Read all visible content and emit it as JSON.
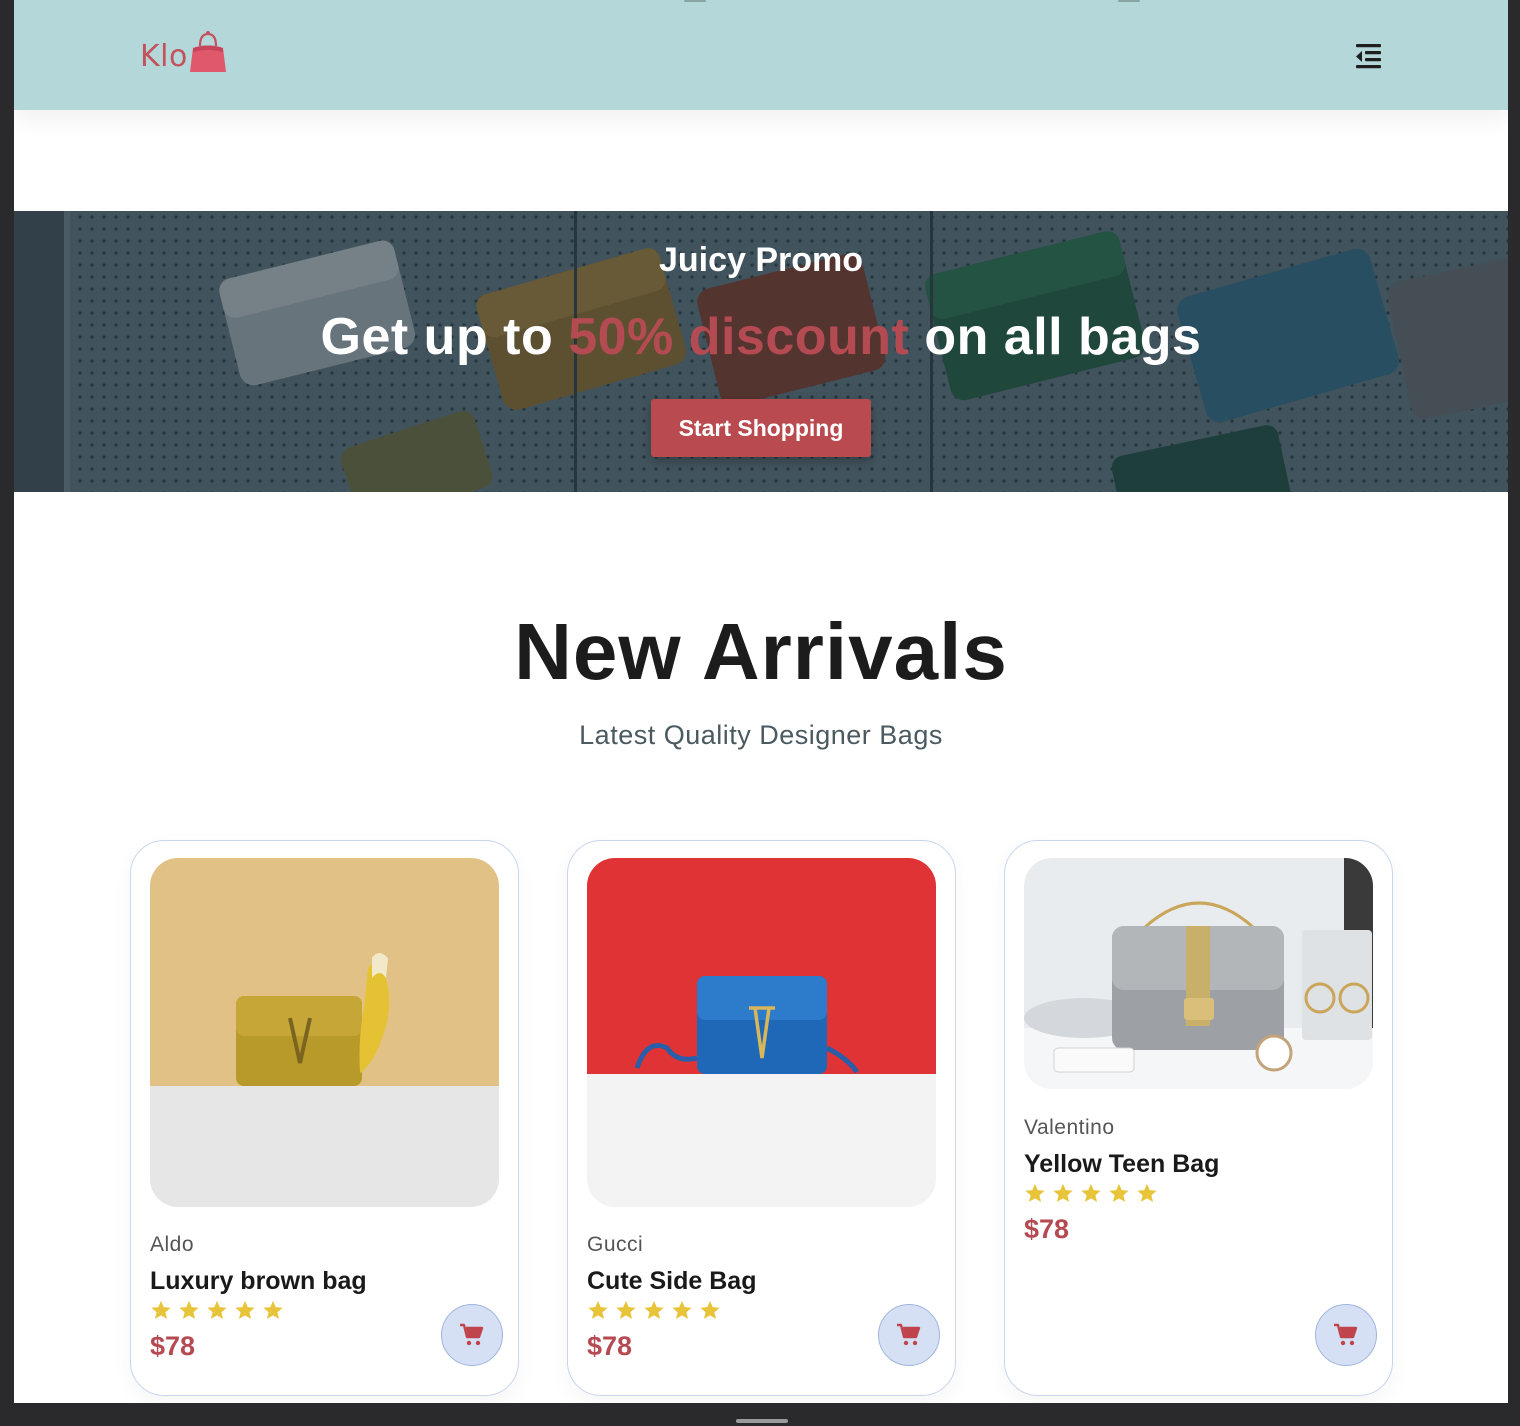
{
  "header": {
    "logo_text": "Klo",
    "background": "#b4d8da",
    "menu_icon": "menu-fold-icon"
  },
  "promo": {
    "kicker": "Juicy Promo",
    "headline_before": "Get up to ",
    "headline_highlight": "50% discount",
    "headline_after": " on all bags",
    "button_label": "Start Shopping",
    "accent": "#b94a4f"
  },
  "arrivals": {
    "title": "New Arrivals",
    "subtitle": "Latest Quality Designer Bags",
    "products": [
      {
        "brand": "Aldo",
        "name": "Luxury brown bag",
        "rating": 5,
        "price": "$78"
      },
      {
        "brand": "Gucci",
        "name": "Cute Side Bag",
        "rating": 5,
        "price": "$78"
      },
      {
        "brand": "Valentino",
        "name": "Yellow Teen Bag",
        "rating": 5,
        "price": "$78"
      }
    ]
  },
  "colors": {
    "price": "#b54a52",
    "star": "#e8c43a",
    "cart_button_bg": "#d6e0f5"
  }
}
